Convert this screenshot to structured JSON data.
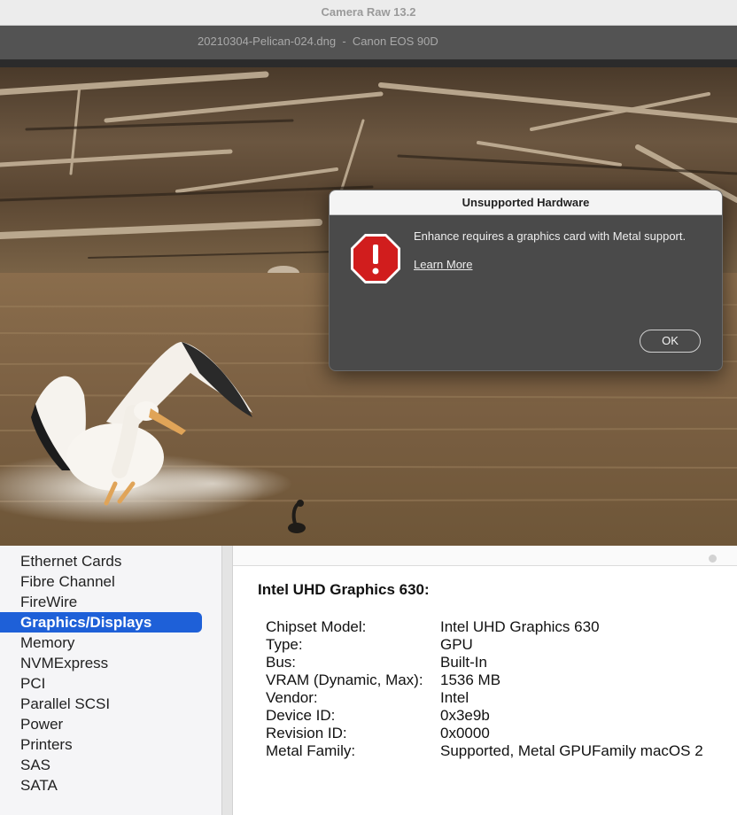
{
  "camera_raw": {
    "app_title": "Camera Raw 13.2",
    "file_info": "20210304-Pelican-024.dng  -  Canon EOS 90D"
  },
  "dialog": {
    "title": "Unsupported Hardware",
    "icon": "alert-stop-icon",
    "message": "Enhance requires a graphics card with Metal support.",
    "link": "Learn More",
    "ok_label": "OK"
  },
  "system_info": {
    "sidebar": {
      "items": [
        {
          "label": "Ethernet Cards"
        },
        {
          "label": "Fibre Channel"
        },
        {
          "label": "FireWire"
        },
        {
          "label": "Graphics/Displays",
          "selected": true
        },
        {
          "label": "Memory"
        },
        {
          "label": "NVMExpress"
        },
        {
          "label": "PCI"
        },
        {
          "label": "Parallel SCSI"
        },
        {
          "label": "Power"
        },
        {
          "label": "Printers"
        },
        {
          "label": "SAS"
        },
        {
          "label": "SATA"
        }
      ],
      "selection_color": "#1e60d8"
    },
    "detail": {
      "title": "Intel UHD Graphics 630:",
      "properties": [
        {
          "key": "Chipset Model:",
          "value": "Intel UHD Graphics 630"
        },
        {
          "key": "Type:",
          "value": "GPU"
        },
        {
          "key": "Bus:",
          "value": "Built-In"
        },
        {
          "key": "VRAM (Dynamic, Max):",
          "value": "1536 MB"
        },
        {
          "key": "Vendor:",
          "value": "Intel"
        },
        {
          "key": "Device ID:",
          "value": "0x3e9b"
        },
        {
          "key": "Revision ID:",
          "value": "0x0000"
        },
        {
          "key": "Metal Family:",
          "value": "Supported, Metal GPUFamily macOS 2"
        }
      ]
    }
  }
}
